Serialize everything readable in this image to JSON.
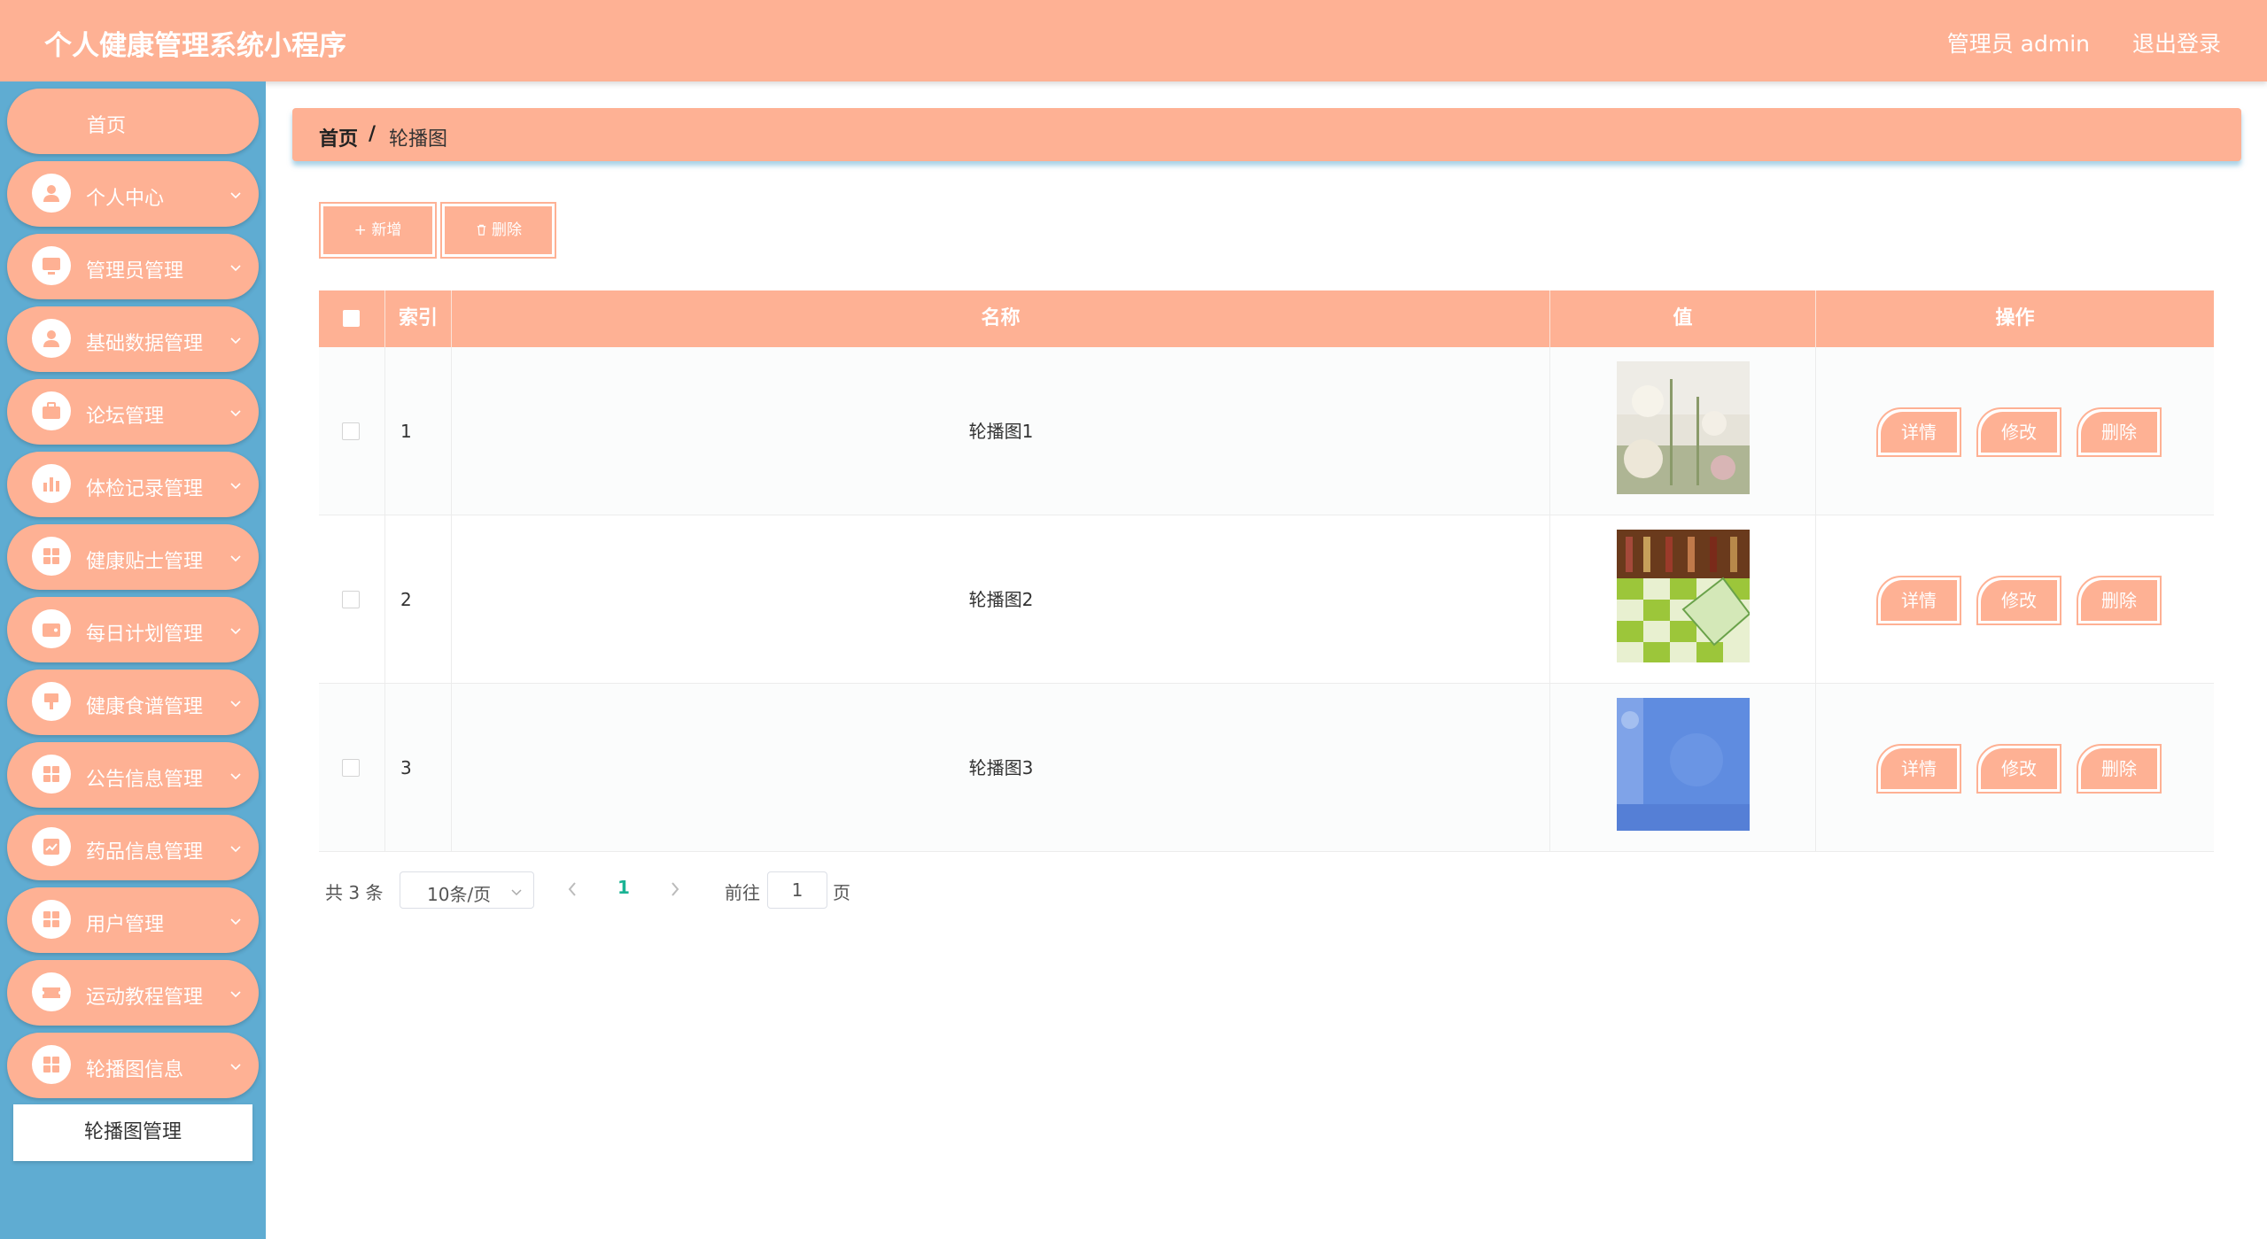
{
  "header": {
    "title": "个人健康管理系统小程序",
    "user": "管理员 admin",
    "logout": "退出登录"
  },
  "sidebar": {
    "items": [
      {
        "label": "首页",
        "icon": "home"
      },
      {
        "label": "个人中心",
        "icon": "user-icon"
      },
      {
        "label": "管理员管理",
        "icon": "monitor-icon"
      },
      {
        "label": "基础数据管理",
        "icon": "user-icon"
      },
      {
        "label": "论坛管理",
        "icon": "briefcase-icon"
      },
      {
        "label": "体检记录管理",
        "icon": "bar-chart-icon"
      },
      {
        "label": "健康贴士管理",
        "icon": "grid-icon"
      },
      {
        "label": "每日计划管理",
        "icon": "wallet-icon"
      },
      {
        "label": "健康食谱管理",
        "icon": "brush-icon"
      },
      {
        "label": "公告信息管理",
        "icon": "grid-icon"
      },
      {
        "label": "药品信息管理",
        "icon": "trend-icon"
      },
      {
        "label": "用户管理",
        "icon": "grid-icon"
      },
      {
        "label": "运动教程管理",
        "icon": "ticket-icon"
      },
      {
        "label": "轮播图信息",
        "icon": "grid-icon"
      }
    ],
    "submenu": "轮播图管理"
  },
  "breadcrumb": {
    "home": "首页",
    "separator": "/",
    "current": "轮播图"
  },
  "toolbar": {
    "add": "+ 新增",
    "delete": "删除"
  },
  "table": {
    "headers": {
      "index": "索引",
      "name": "名称",
      "value": "值",
      "actions": "操作"
    },
    "rows": [
      {
        "index": "1",
        "name": "轮播图1",
        "image": "flowers-photo"
      },
      {
        "index": "2",
        "name": "轮播图2",
        "image": "checkered-cloth-photo"
      },
      {
        "index": "3",
        "name": "轮播图3",
        "image": "blue-texture-photo"
      }
    ],
    "actions": {
      "detail": "详情",
      "edit": "修改",
      "delete": "删除"
    }
  },
  "pagination": {
    "total": "共 3 条",
    "page_size": "10条/页",
    "current_page": "1",
    "goto_label": "前往",
    "goto_value": "1",
    "page_suffix": "页"
  },
  "colors": {
    "primary": "#FEB194",
    "sidebar": "#5FACD2",
    "active_page": "#1ab394"
  }
}
